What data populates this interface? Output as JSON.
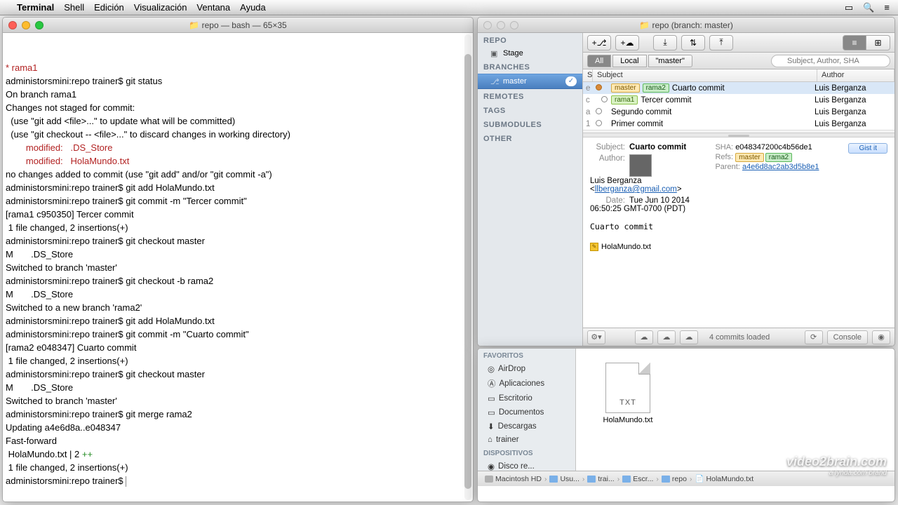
{
  "menubar": {
    "app": "Terminal",
    "items": [
      "Shell",
      "Edición",
      "Visualización",
      "Ventana",
      "Ayuda"
    ]
  },
  "terminal": {
    "title": "repo — bash — 65×35",
    "lines": [
      {
        "cls": "red-t",
        "text": "* rama1"
      },
      {
        "cls": "",
        "text": "administorsmini:repo trainer$ git status"
      },
      {
        "cls": "",
        "text": "On branch rama1"
      },
      {
        "cls": "",
        "text": "Changes not staged for commit:"
      },
      {
        "cls": "",
        "text": "  (use \"git add <file>...\" to update what will be committed)"
      },
      {
        "cls": "",
        "text": "  (use \"git checkout -- <file>...\" to discard changes in working directory)"
      },
      {
        "cls": "",
        "text": ""
      },
      {
        "cls": "red-t",
        "text": "        modified:   .DS_Store"
      },
      {
        "cls": "red-t",
        "text": "        modified:   HolaMundo.txt"
      },
      {
        "cls": "",
        "text": ""
      },
      {
        "cls": "",
        "text": "no changes added to commit (use \"git add\" and/or \"git commit -a\")"
      },
      {
        "cls": "",
        "text": "administorsmini:repo trainer$ git add HolaMundo.txt"
      },
      {
        "cls": "",
        "text": "administorsmini:repo trainer$ git commit -m \"Tercer commit\""
      },
      {
        "cls": "",
        "text": "[rama1 c950350] Tercer commit"
      },
      {
        "cls": "",
        "text": " 1 file changed, 2 insertions(+)"
      },
      {
        "cls": "",
        "text": "administorsmini:repo trainer$ git checkout master"
      },
      {
        "cls": "",
        "text": "M       .DS_Store"
      },
      {
        "cls": "",
        "text": "Switched to branch 'master'"
      },
      {
        "cls": "",
        "text": "administorsmini:repo trainer$ git checkout -b rama2"
      },
      {
        "cls": "",
        "text": "M       .DS_Store"
      },
      {
        "cls": "",
        "text": "Switched to a new branch 'rama2'"
      },
      {
        "cls": "",
        "text": "administorsmini:repo trainer$ git add HolaMundo.txt"
      },
      {
        "cls": "",
        "text": "administorsmini:repo trainer$ git commit -m \"Cuarto commit\""
      },
      {
        "cls": "",
        "text": "[rama2 e048347] Cuarto commit"
      },
      {
        "cls": "",
        "text": " 1 file changed, 2 insertions(+)"
      },
      {
        "cls": "",
        "text": "administorsmini:repo trainer$ git checkout master"
      },
      {
        "cls": "",
        "text": "M       .DS_Store"
      },
      {
        "cls": "",
        "text": "Switched to branch 'master'"
      },
      {
        "cls": "",
        "text": "administorsmini:repo trainer$ git merge rama2"
      },
      {
        "cls": "",
        "text": "Updating a4e6d8a..e048347"
      },
      {
        "cls": "",
        "text": "Fast-forward"
      },
      {
        "cls": "mix",
        "text": " HolaMundo.txt | 2 ++"
      },
      {
        "cls": "",
        "text": " 1 file changed, 2 insertions(+)"
      },
      {
        "cls": "prompt",
        "text": "administorsmini:repo trainer$ "
      }
    ]
  },
  "gitapp": {
    "title": "repo (branch: master)",
    "side": {
      "repo": "REPO",
      "stage": "Stage",
      "branches": "BRANCHES",
      "master": "master",
      "remotes": "REMOTES",
      "tags": "TAGS",
      "submodules": "SUBMODULES",
      "other": "OTHER"
    },
    "filter": {
      "all": "All",
      "local": "Local",
      "master": "\"master\"",
      "placeholder": "Subject, Author, SHA"
    },
    "cols": {
      "s": "S",
      "subject": "Subject",
      "author": "Author"
    },
    "commits": [
      {
        "s": "e",
        "tags": [
          "master",
          "rama2"
        ],
        "subject": "Cuarto commit",
        "author": "Luis Berganza",
        "sel": true,
        "fill": true
      },
      {
        "s": "c",
        "tags": [
          "rama1"
        ],
        "subject": "Tercer commit",
        "author": "Luis Berganza",
        "offset": true
      },
      {
        "s": "a",
        "tags": [],
        "subject": "Segundo commit",
        "author": "Luis Berganza"
      },
      {
        "s": "1",
        "tags": [],
        "subject": "Primer commit",
        "author": "Luis Berganza"
      }
    ],
    "detail": {
      "subject_lbl": "Subject:",
      "subject": "Cuarto commit",
      "author_lbl": "Author:",
      "author_name": "Luis Berganza",
      "author_email": "llberganza@gmail.com",
      "date_lbl": "Date:",
      "date": "Tue Jun 10 2014 06:50:25 GMT-0700 (PDT)",
      "sha_lbl": "SHA:",
      "sha": "e048347200c4b56de1",
      "refs_lbl": "Refs:",
      "parent_lbl": "Parent:",
      "parent": "a4e6d8ac2ab3d5b8e1",
      "gist": "Gist it",
      "message": "Cuarto commit",
      "file": "HolaMundo.txt"
    },
    "status": {
      "loaded": "4 commits loaded",
      "console": "Console"
    }
  },
  "finder": {
    "fav": "FAVORITOS",
    "items": [
      "AirDrop",
      "Aplicaciones",
      "Escritorio",
      "Documentos",
      "Descargas",
      "trainer"
    ],
    "dev": "DISPOSITIVOS",
    "disk": "Disco re...",
    "file": {
      "ext": "TXT",
      "name": "HolaMundo.txt"
    },
    "path": [
      "Macintosh HD",
      "Usu...",
      "trai...",
      "Escr...",
      "repo",
      "HolaMundo.txt"
    ]
  },
  "watermark": {
    "main": "video2brain.com",
    "sub": "a lynda.com brand"
  }
}
